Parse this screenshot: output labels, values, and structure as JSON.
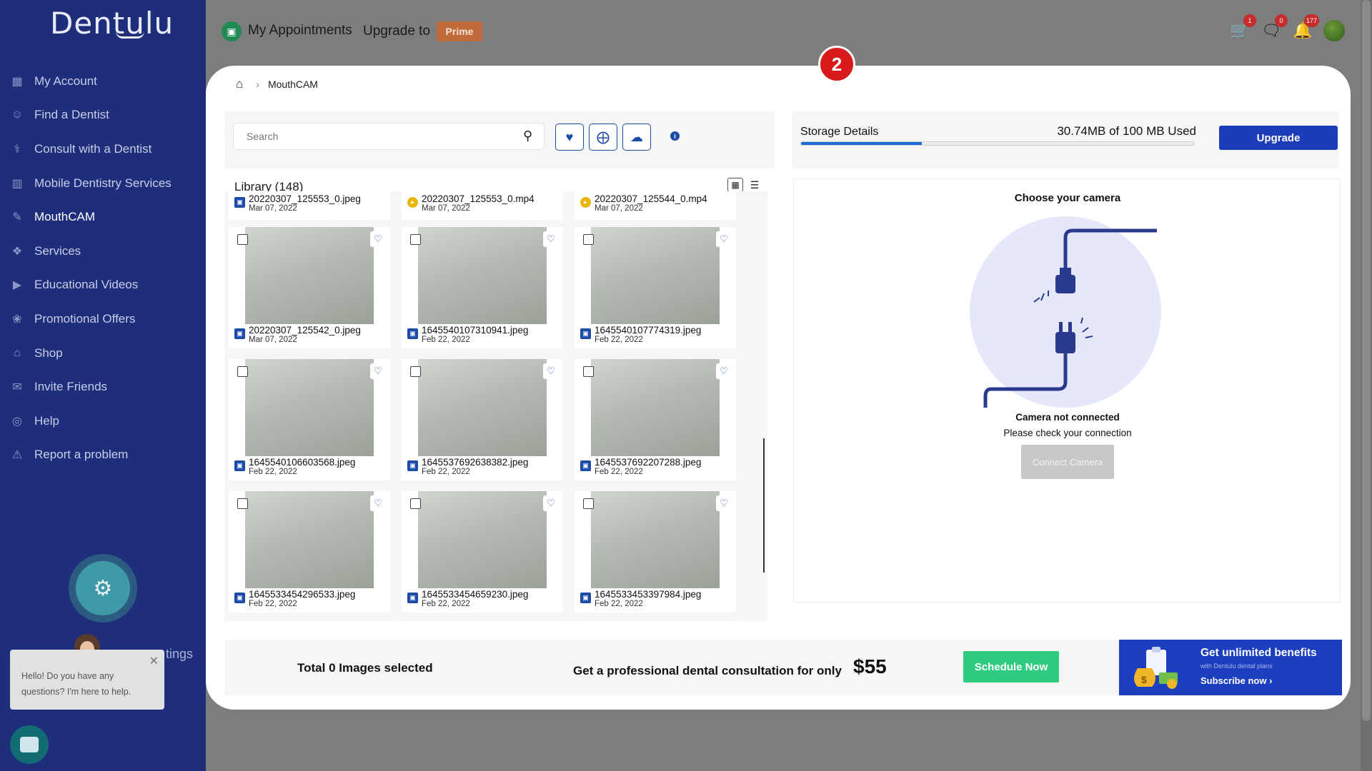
{
  "brand": {
    "name": "Dentulu"
  },
  "sidebar": {
    "items": [
      {
        "label": "My Account",
        "icon": "grid-icon"
      },
      {
        "label": "Find a Dentist",
        "icon": "user-search-icon"
      },
      {
        "label": "Consult with a Dentist",
        "icon": "consult-icon"
      },
      {
        "label": "Mobile Dentistry Services",
        "icon": "building-icon"
      },
      {
        "label": "MouthCAM",
        "icon": "camera-pen-icon"
      },
      {
        "label": "Services",
        "icon": "services-icon"
      },
      {
        "label": "Educational Videos",
        "icon": "video-icon"
      },
      {
        "label": "Promotional Offers",
        "icon": "offer-icon"
      },
      {
        "label": "Shop",
        "icon": "store-icon"
      },
      {
        "label": "Invite Friends",
        "icon": "invite-icon"
      },
      {
        "label": "Help",
        "icon": "help-icon"
      },
      {
        "label": "Report a problem",
        "icon": "warning-icon"
      }
    ],
    "settings_fragment": "tings",
    "chat": {
      "message": "Hello! Do you have any questions? I'm here to help."
    }
  },
  "topbar": {
    "title": "My Appointments",
    "upgrade_text": "Upgrade to",
    "prime_label": "Prime",
    "cart_count": "1",
    "messages_count": "0",
    "notifications_count": "177"
  },
  "step_badge": "2",
  "breadcrumb": {
    "current": "MouthCAM"
  },
  "search": {
    "placeholder": "Search"
  },
  "library": {
    "title": "Library (148)",
    "items": [
      {
        "name": "20220307_125553_0.jpeg",
        "date": "Mar 07, 2022",
        "type": "image",
        "partial": true
      },
      {
        "name": "20220307_125553_0.mp4",
        "date": "Mar 07, 2022",
        "type": "video",
        "partial": true
      },
      {
        "name": "20220307_125544_0.mp4",
        "date": "Mar 07, 2022",
        "type": "video",
        "partial": true
      },
      {
        "name": "20220307_125542_0.jpeg",
        "date": "Mar 07, 2022",
        "type": "image"
      },
      {
        "name": "1645540107310941.jpeg",
        "date": "Feb 22, 2022",
        "type": "image"
      },
      {
        "name": "1645540107774319.jpeg",
        "date": "Feb 22, 2022",
        "type": "image"
      },
      {
        "name": "1645540106603568.jpeg",
        "date": "Feb 22, 2022",
        "type": "image"
      },
      {
        "name": "1645537692638382.jpeg",
        "date": "Feb 22, 2022",
        "type": "image"
      },
      {
        "name": "1645537692207288.jpeg",
        "date": "Feb 22, 2022",
        "type": "image"
      },
      {
        "name": "1645533454296533.jpeg",
        "date": "Feb 22, 2022",
        "type": "image"
      },
      {
        "name": "1645533454659230.jpeg",
        "date": "Feb 22, 2022",
        "type": "image"
      },
      {
        "name": "1645533453397984.jpeg",
        "date": "Feb 22, 2022",
        "type": "image"
      }
    ]
  },
  "storage": {
    "label": "Storage Details",
    "used_text": "30.74MB of 100 MB Used",
    "used_fraction": 0.3074,
    "upgrade_label": "Upgrade"
  },
  "camera": {
    "title": "Choose your camera",
    "status": "Camera not connected",
    "hint": "Please check your connection",
    "connect_label": "Connect Camera"
  },
  "bottom": {
    "selection": "Total 0 Images selected",
    "consult_text": "Get a professional dental consultation for only",
    "price": "$55",
    "schedule_label": "Schedule Now"
  },
  "promo": {
    "title": "Get unlimited benefits",
    "subtitle": "with Dentulu dental plans",
    "cta": "Subscribe now ›"
  },
  "colors": {
    "sidebar_bg": "#1e2e7a",
    "accent_blue": "#1d3cba",
    "prime": "#c06a3c",
    "schedule_green": "#2fcb7f",
    "badge_red": "#d91a1a"
  }
}
